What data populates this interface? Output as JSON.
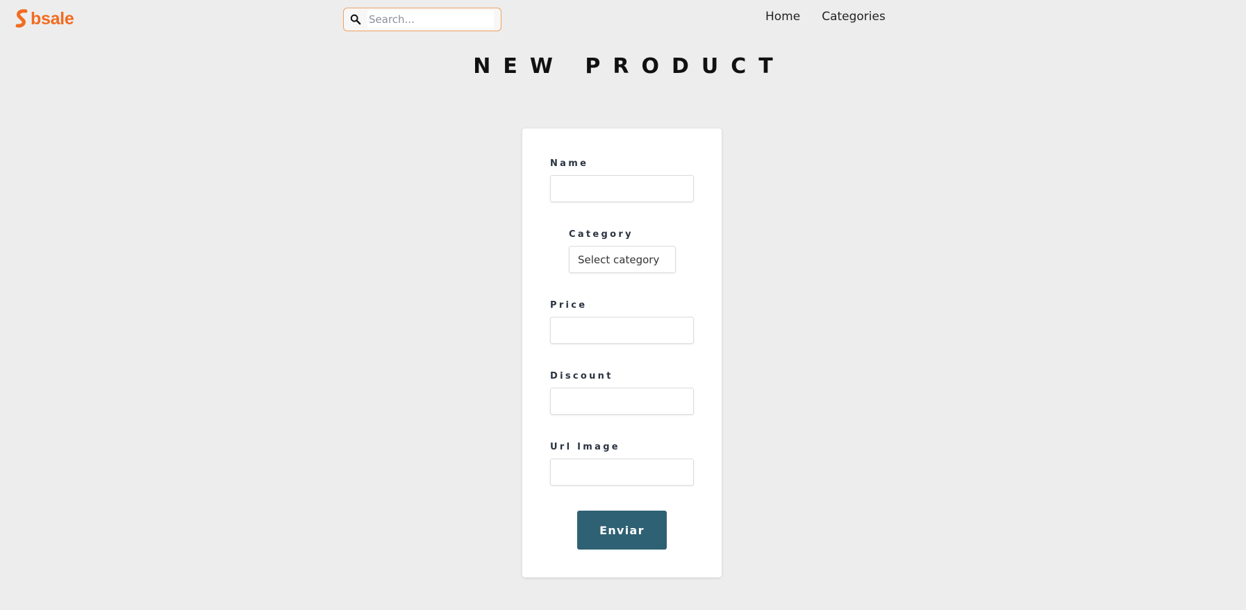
{
  "brand": {
    "name": "bsale",
    "color": "#f26b21"
  },
  "search": {
    "placeholder": "Search...",
    "icon": "search-icon"
  },
  "nav": {
    "items": [
      {
        "label": "Home"
      },
      {
        "label": "Categories"
      }
    ]
  },
  "page": {
    "title": "NEW PRODUCT"
  },
  "form": {
    "fields": {
      "name": {
        "label": "Name",
        "value": ""
      },
      "category": {
        "label": "Category",
        "selected": "Select category"
      },
      "price": {
        "label": "Price",
        "value": ""
      },
      "discount": {
        "label": "Discount",
        "value": ""
      },
      "url_image": {
        "label": "Url Image",
        "value": ""
      }
    },
    "submit_label": "Enviar",
    "submit_color": "#2e6173"
  }
}
